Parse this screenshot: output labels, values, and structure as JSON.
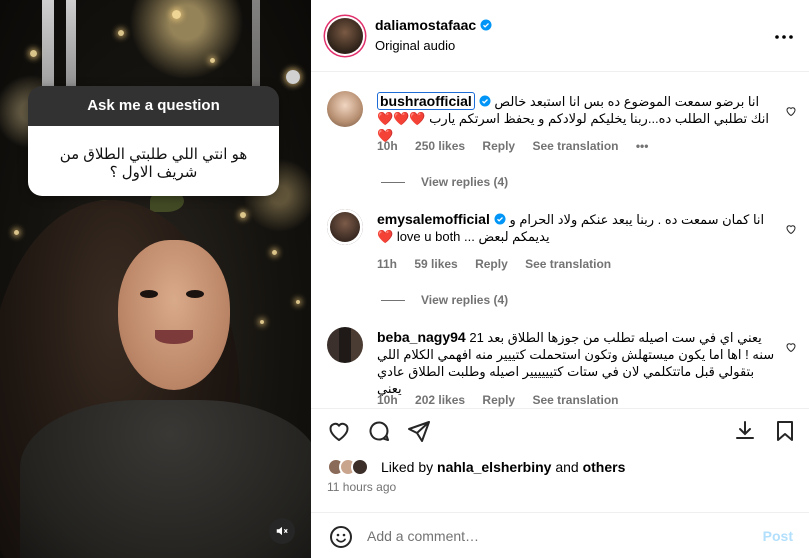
{
  "video": {
    "question_title": "Ask me a question",
    "question_text": "هو انتي اللي طلبتي الطلاق من شريف الاول ؟"
  },
  "post": {
    "author": "daliamostafaac",
    "audio": "Original audio",
    "more": "•••"
  },
  "comments": [
    {
      "user": "bushraofficial",
      "verified": true,
      "text": "انا برضو سمعت الموضوع ده بس انا استبعد خالص انك تطلبي الطلب ده...ربنا يخليكم لولادكم و يحفظ اسرتكم يارب ❤️❤️❤️❤️",
      "time": "10h",
      "likes": "250 likes",
      "reply": "Reply",
      "translate": "See translation",
      "dots": "•••",
      "view_replies": "View replies (4)"
    },
    {
      "user": "emysalemofficial",
      "verified": true,
      "text": "انا كمان سمعت ده . ربنا يبعد عنكم ولاد الحرام و يديمكم لبعض ... love u both ❤️",
      "time": "11h",
      "likes": "59 likes",
      "reply": "Reply",
      "translate": "See translation",
      "view_replies": "View replies (4)"
    },
    {
      "user": "beba_nagy94",
      "verified": false,
      "text": "يعني اي في ست اصيله تطلب من جوزها الطلاق بعد 21 سنه ! اها اما يكون ميستهلش وتكون استحملت كتييير منه افهمي الكلام اللي بتقولي قبل ماتتكلمي لان في ستات كتيييييير اصيله وطلبت الطلاق عادي يعني",
      "time": "10h",
      "likes": "202 likes",
      "reply": "Reply",
      "translate": "See translation"
    }
  ],
  "likes": {
    "prefix": "Liked by",
    "user": "nahla_elsherbiny",
    "and": "and",
    "others": "others"
  },
  "time_ago": "11 hours ago",
  "add_comment": {
    "placeholder": "Add a comment…",
    "post_label": "Post"
  },
  "colors": {
    "accent": "#0095f6",
    "verified": "#0095f6",
    "post_disabled": "#b2dffc",
    "muted": "#737373"
  },
  "icons": [
    "heart-icon",
    "comment-icon",
    "share-icon",
    "download-icon",
    "bookmark-icon",
    "emoji-icon",
    "mute-icon",
    "more-icon",
    "verified-badge-icon"
  ]
}
